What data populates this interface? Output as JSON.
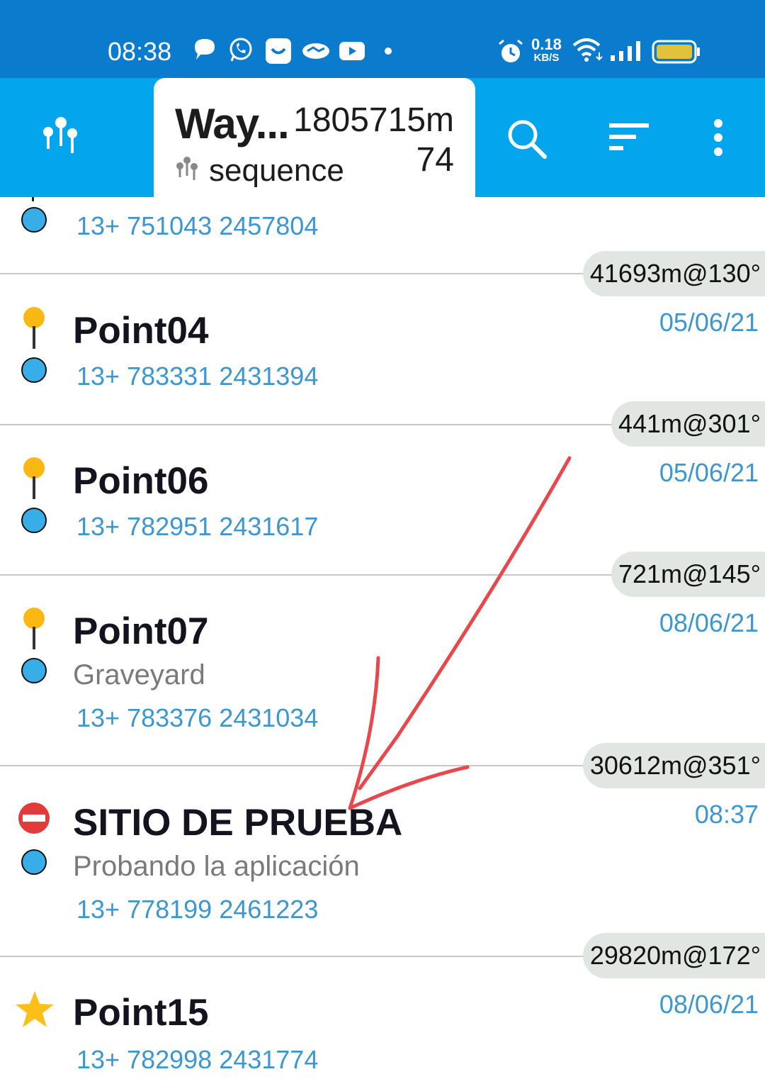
{
  "status_bar": {
    "time": "08:38",
    "speed_value": "0.18",
    "speed_unit": "KB/S"
  },
  "app_bar": {
    "tab_title": "Way...",
    "tab_distance": "1805715m",
    "tab_count": "74",
    "tab_subtitle": "sequence"
  },
  "list": {
    "partial_coords": "13+ 751043 2457804",
    "items": [
      {
        "bearing": "41693m@130°",
        "name": "Point04",
        "date": "05/06/21",
        "coords": "13+ 783331 2431394",
        "icon": "yellow-pin-icon"
      },
      {
        "bearing": "441m@301°",
        "name": "Point06",
        "date": "05/06/21",
        "coords": "13+ 782951 2431617",
        "icon": "yellow-pin-icon"
      },
      {
        "bearing": "721m@145°",
        "name": "Point07",
        "date": "08/06/21",
        "description": "Graveyard",
        "coords": "13+ 783376 2431034",
        "icon": "yellow-pin-icon"
      },
      {
        "bearing": "30612m@351°",
        "name": "SITIO DE PRUEBA",
        "date": "08:37",
        "description": "Probando la aplicación",
        "coords": "13+ 778199 2461223",
        "icon": "no-entry-icon"
      },
      {
        "bearing": "29820m@172°",
        "name": "Point15",
        "date": "08/06/21",
        "coords": "13+ 782998 2431774",
        "icon": "star-icon"
      }
    ]
  },
  "colors": {
    "status_bar": "#0b7ccd",
    "app_bar": "#03a6ec",
    "link": "#3c97d0",
    "annotation": "#e8484c"
  }
}
